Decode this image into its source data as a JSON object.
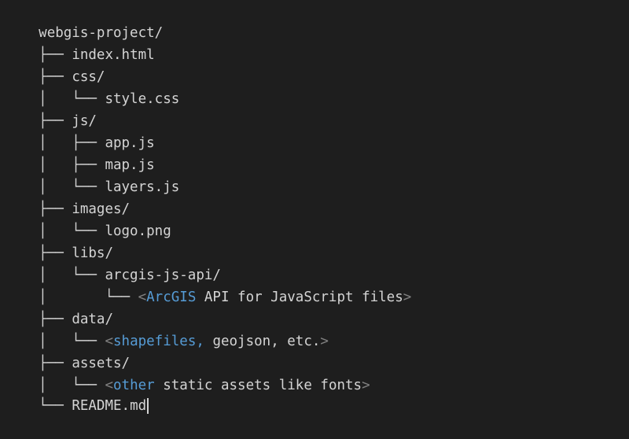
{
  "tree": {
    "root": "webgis-project/",
    "lines": [
      {
        "prefix": "├── ",
        "name": "index.html"
      },
      {
        "prefix": "├── ",
        "name": "css/"
      },
      {
        "prefix": "│   └── ",
        "name": "style.css"
      },
      {
        "prefix": "├── ",
        "name": "js/"
      },
      {
        "prefix": "│   ├── ",
        "name": "app.js"
      },
      {
        "prefix": "│   ├── ",
        "name": "map.js"
      },
      {
        "prefix": "│   └── ",
        "name": "layers.js"
      },
      {
        "prefix": "├── ",
        "name": "images/"
      },
      {
        "prefix": "│   └── ",
        "name": "logo.png"
      },
      {
        "prefix": "├── ",
        "name": "libs/"
      },
      {
        "prefix": "│   └── ",
        "name": "arcgis-js-api/"
      },
      {
        "prefix": "│       └── ",
        "comment_open": "<",
        "comment_kw": "ArcGIS",
        "comment_rest": " API for JavaScript files",
        "comment_close": ">"
      },
      {
        "prefix": "├── ",
        "name": "data/"
      },
      {
        "prefix": "│   └── ",
        "comment_open": "<",
        "comment_kw": "shapefiles,",
        "comment_rest": " geojson, etc.",
        "comment_close": ">"
      },
      {
        "prefix": "├── ",
        "name": "assets/"
      },
      {
        "prefix": "│   └── ",
        "comment_open": "<",
        "comment_kw": "other",
        "comment_rest": " static assets like fonts",
        "comment_close": ">"
      },
      {
        "prefix": "└── ",
        "name": "README.md"
      }
    ]
  }
}
